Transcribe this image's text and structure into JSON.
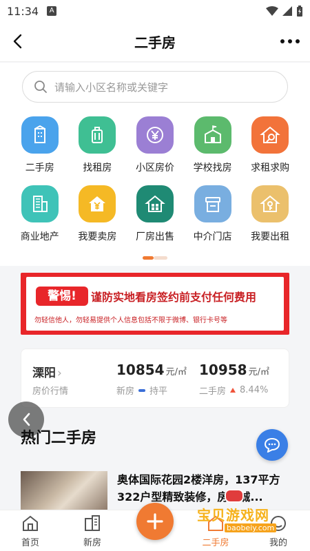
{
  "status_bar": {
    "time": "11:34",
    "notification_letter": "A"
  },
  "header": {
    "title": "二手房"
  },
  "search": {
    "placeholder": "请输入小区名称或关键字"
  },
  "grid": {
    "row1": [
      {
        "label": "二手房",
        "icon": "building-icon",
        "color": "#4aa3ec"
      },
      {
        "label": "找租房",
        "icon": "luggage-icon",
        "color": "#3fbf93"
      },
      {
        "label": "小区房价",
        "icon": "yen-coin-icon",
        "color": "#9b7fd4"
      },
      {
        "label": "学校找房",
        "icon": "school-icon",
        "color": "#5cba6d"
      },
      {
        "label": "求租求购",
        "icon": "house-search-icon",
        "color": "#f2733a"
      }
    ],
    "row2": [
      {
        "label": "商业地产",
        "icon": "office-tower-icon",
        "color": "#3fc3b8"
      },
      {
        "label": "我要卖房",
        "icon": "house-yen-icon",
        "color": "#f5b925"
      },
      {
        "label": "厂房出售",
        "icon": "factory-icon",
        "color": "#1f8a74"
      },
      {
        "label": "中介门店",
        "icon": "shop-icon",
        "color": "#79aee0"
      },
      {
        "label": "我要出租",
        "icon": "house-key-icon",
        "color": "#ebc06c"
      }
    ]
  },
  "warning": {
    "badge": "警惕!",
    "headline": "谨防实地看房签约前支付任何费用",
    "sub": "勿轻信他人，勿轻易提供个人信息包括不限于微博、银行卡号等"
  },
  "price": {
    "city": "溧阳",
    "city_sub": "房价行情",
    "new_price": "10854",
    "new_unit": "元/㎡",
    "new_label": "新房",
    "new_trend": "持平",
    "used_price": "10958",
    "used_unit": "元/㎡",
    "used_label": "二手房",
    "used_trend": "8.44%"
  },
  "section": {
    "title": "热门二手房"
  },
  "listing": {
    "title": "奥体国际花园2楼洋房，137平方322户型精致装修，房东诚..."
  },
  "tabbar": {
    "tabs": [
      {
        "label": "首页",
        "icon": "home-icon"
      },
      {
        "label": "新房",
        "icon": "new-house-icon"
      },
      {
        "label": "二手房",
        "icon": "used-house-icon"
      },
      {
        "label": "我的",
        "icon": "profile-icon"
      }
    ],
    "fab_icon": "plus-icon",
    "accent": "#f07a32"
  },
  "watermark": {
    "text": "宝贝游戏网",
    "url": "baobeiy.com"
  }
}
